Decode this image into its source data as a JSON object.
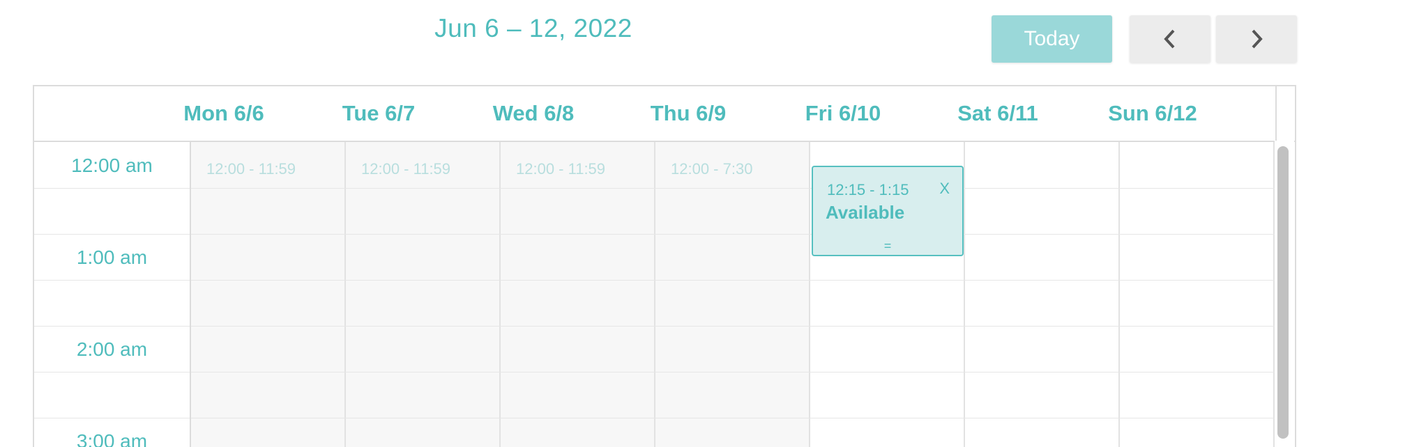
{
  "header": {
    "date_range": "Jun 6 – 12, 2022",
    "today_label": "Today",
    "prev_icon": "chevron-left-icon",
    "next_icon": "chevron-right-icon"
  },
  "days": [
    {
      "label": "Mon 6/6",
      "availability": "12:00 - 11:59"
    },
    {
      "label": "Tue 6/7",
      "availability": "12:00 - 11:59"
    },
    {
      "label": "Wed 6/8",
      "availability": "12:00 - 11:59"
    },
    {
      "label": "Thu 6/9",
      "availability": "12:00 - 7:30"
    },
    {
      "label": "Fri 6/10",
      "availability": ""
    },
    {
      "label": "Sat 6/11",
      "availability": ""
    },
    {
      "label": "Sun 6/12",
      "availability": ""
    }
  ],
  "times": [
    "12:00 am",
    "1:00 am",
    "2:00 am",
    "3:00 am"
  ],
  "event": {
    "time": "12:15 - 1:15",
    "title": "Available",
    "close_label": "X",
    "resize_handle": "="
  },
  "colors": {
    "accent": "#4fbcbc",
    "today_button": "#9ad8d9",
    "event_bg": "#d8eeee",
    "shaded_bg": "#f7f7f7"
  }
}
